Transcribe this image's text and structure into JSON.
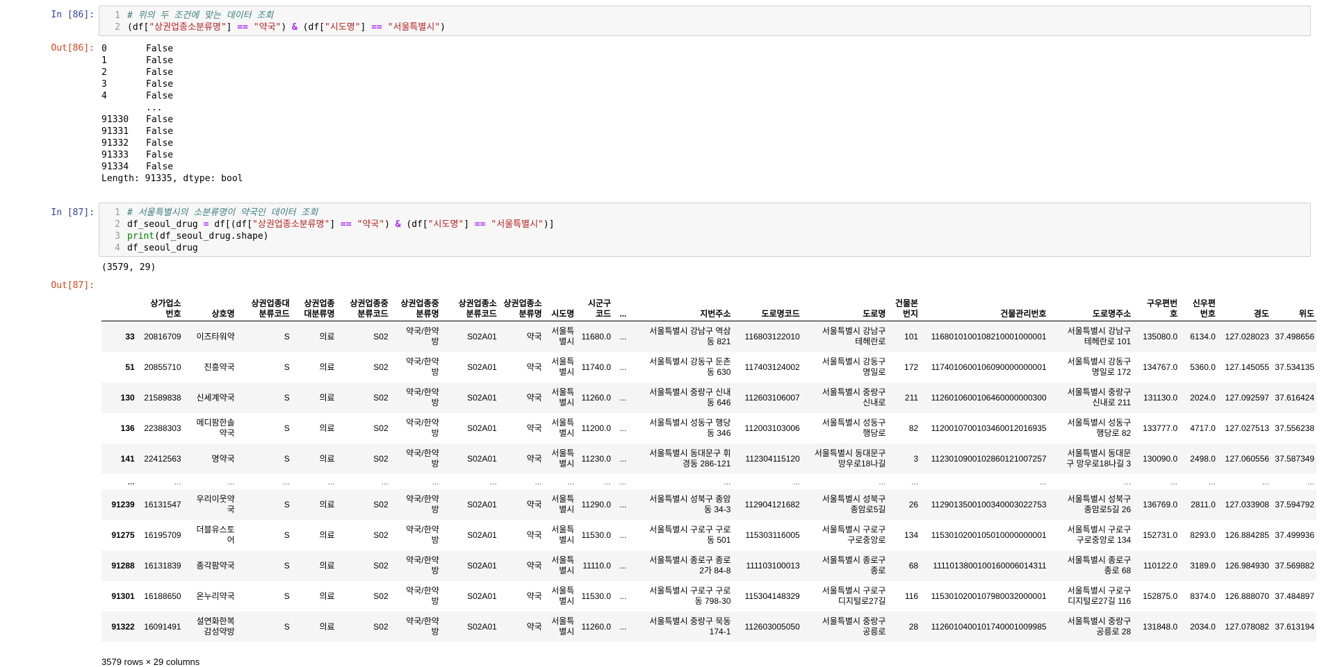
{
  "cell86": {
    "in_prompt": "In [86]:",
    "out_prompt": "Out[86]:",
    "code": [
      {
        "n": "1",
        "parts": [
          {
            "t": "# 위의 두 조건에 맞는 데이터 조회",
            "c": "comment"
          }
        ]
      },
      {
        "n": "2",
        "parts": [
          {
            "t": "(df[",
            "c": "paren"
          },
          {
            "t": "\"상권업종소분류명\"",
            "c": "str"
          },
          {
            "t": "] ",
            "c": "paren"
          },
          {
            "t": "==",
            "c": "op"
          },
          {
            "t": " ",
            "c": "paren"
          },
          {
            "t": "\"약국\"",
            "c": "str"
          },
          {
            "t": ") ",
            "c": "paren"
          },
          {
            "t": "&",
            "c": "op"
          },
          {
            "t": " (df[",
            "c": "paren"
          },
          {
            "t": "\"시도명\"",
            "c": "str"
          },
          {
            "t": "] ",
            "c": "paren"
          },
          {
            "t": "==",
            "c": "op"
          },
          {
            "t": " ",
            "c": "paren"
          },
          {
            "t": "\"서울특별시\"",
            "c": "str"
          },
          {
            "t": ")",
            "c": "paren"
          }
        ]
      }
    ],
    "series": [
      {
        "idx": "0",
        "val": "False"
      },
      {
        "idx": "1",
        "val": "False"
      },
      {
        "idx": "2",
        "val": "False"
      },
      {
        "idx": "3",
        "val": "False"
      },
      {
        "idx": "4",
        "val": "False"
      },
      {
        "idx": "",
        "val": "..."
      },
      {
        "idx": "91330",
        "val": "False"
      },
      {
        "idx": "91331",
        "val": "False"
      },
      {
        "idx": "91332",
        "val": "False"
      },
      {
        "idx": "91333",
        "val": "False"
      },
      {
        "idx": "91334",
        "val": "False"
      }
    ],
    "series_footer": "Length: 91335, dtype: bool"
  },
  "cell87": {
    "in_prompt": "In [87]:",
    "out_prompt": "Out[87]:",
    "code": [
      {
        "n": "1",
        "parts": [
          {
            "t": "# 서울특별시의 소분류명이 약국인 데이터 조회",
            "c": "comment"
          }
        ]
      },
      {
        "n": "2",
        "parts": [
          {
            "t": "df_seoul_drug ",
            "c": "paren"
          },
          {
            "t": "=",
            "c": "op"
          },
          {
            "t": " df[(df[",
            "c": "paren"
          },
          {
            "t": "\"상권업종소분류명\"",
            "c": "str"
          },
          {
            "t": "] ",
            "c": "paren"
          },
          {
            "t": "==",
            "c": "op"
          },
          {
            "t": " ",
            "c": "paren"
          },
          {
            "t": "\"약국\"",
            "c": "str"
          },
          {
            "t": ") ",
            "c": "paren"
          },
          {
            "t": "&",
            "c": "op"
          },
          {
            "t": " (df[",
            "c": "paren"
          },
          {
            "t": "\"시도명\"",
            "c": "str"
          },
          {
            "t": "] ",
            "c": "paren"
          },
          {
            "t": "==",
            "c": "op"
          },
          {
            "t": " ",
            "c": "paren"
          },
          {
            "t": "\"서울특별시\"",
            "c": "str"
          },
          {
            "t": ")]",
            "c": "paren"
          }
        ]
      },
      {
        "n": "3",
        "parts": [
          {
            "t": "print",
            "c": "kw"
          },
          {
            "t": "(df_seoul_drug.shape)",
            "c": "paren"
          }
        ]
      },
      {
        "n": "4",
        "parts": [
          {
            "t": "df_seoul_drug",
            "c": "paren"
          }
        ]
      }
    ],
    "stdout": "(3579, 29)",
    "table": {
      "columns": [
        "",
        "상가업소\n번호",
        "상호명",
        "상권업종대\n분류코드",
        "상권업종\n대분류명",
        "상권업종중\n분류코드",
        "상권업종중\n분류명",
        "상권업종소\n분류코드",
        "상권업종소\n분류명",
        "시도명",
        "시군구\n코드",
        "...",
        "지번주소",
        "도로명코드",
        "도로명",
        "건물본\n번지",
        "건물관리번호",
        "도로명주소",
        "구우편번\n호",
        "신우편\n번호",
        "경도",
        "위도"
      ],
      "rows": [
        [
          "33",
          "20816709",
          "이즈타워약",
          "S",
          "의료",
          "S02",
          "약국/한약\n방",
          "S02A01",
          "약국",
          "서울특\n별시",
          "11680.0",
          "...",
          "서울특별시 강남구 역삼\n동 821",
          "116803122010",
          "서울특별시 강남구\n테헤란로",
          "101",
          "1168010100108210001000001",
          "서울특별시 강남구\n테헤란로 101",
          "135080.0",
          "6134.0",
          "127.028023",
          "37.498656"
        ],
        [
          "51",
          "20855710",
          "진흥약국",
          "S",
          "의료",
          "S02",
          "약국/한약\n방",
          "S02A01",
          "약국",
          "서울특\n별시",
          "11740.0",
          "...",
          "서울특별시 강동구 둔촌\n동 630",
          "117403124002",
          "서울특별시 강동구\n명일로",
          "172",
          "1174010600106090000000001",
          "서울특별시 강동구\n명일로 172",
          "134767.0",
          "5360.0",
          "127.145055",
          "37.534135"
        ],
        [
          "130",
          "21589838",
          "신세계약국",
          "S",
          "의료",
          "S02",
          "약국/한약\n방",
          "S02A01",
          "약국",
          "서울특\n별시",
          "11260.0",
          "...",
          "서울특별시 중랑구 신내\n동 646",
          "112603106007",
          "서울특별시 중랑구\n신내로",
          "211",
          "1126010600106460000000300",
          "서울특별시 중랑구\n신내로 211",
          "131130.0",
          "2024.0",
          "127.092597",
          "37.616424"
        ],
        [
          "136",
          "22388303",
          "메디팜한솔\n약국",
          "S",
          "의료",
          "S02",
          "약국/한약\n방",
          "S02A01",
          "약국",
          "서울특\n별시",
          "11200.0",
          "...",
          "서울특별시 성동구 행당\n동 346",
          "112003103006",
          "서울특별시 성동구\n행당로",
          "82",
          "1120010700103460012016935",
          "서울특별시 성동구\n행당로 82",
          "133777.0",
          "4717.0",
          "127.027513",
          "37.556238"
        ],
        [
          "141",
          "22412563",
          "명약국",
          "S",
          "의료",
          "S02",
          "약국/한약\n방",
          "S02A01",
          "약국",
          "서울특\n별시",
          "11230.0",
          "...",
          "서울특별시 동대문구 휘\n경동 286-121",
          "112304115120",
          "서울특별시 동대문구\n망우로18나길",
          "3",
          "1123010900102860121007257",
          "서울특별시 동대문\n구 망우로18나길 3",
          "130090.0",
          "2498.0",
          "127.060556",
          "37.587349"
        ],
        [
          "...",
          "...",
          "...",
          "...",
          "...",
          "...",
          "...",
          "...",
          "...",
          "...",
          "...",
          "...",
          "...",
          "...",
          "...",
          "...",
          "...",
          "...",
          "...",
          "...",
          "...",
          "..."
        ],
        [
          "91239",
          "16131547",
          "우리이웃약\n국",
          "S",
          "의료",
          "S02",
          "약국/한약\n방",
          "S02A01",
          "약국",
          "서울특\n별시",
          "11290.0",
          "...",
          "서울특별시 성북구 종암\n동 34-3",
          "112904121682",
          "서울특별시 성북구\n종암로5길",
          "26",
          "1129013500100340003022753",
          "서울특별시 성북구\n종암로5길 26",
          "136769.0",
          "2811.0",
          "127.033908",
          "37.594792"
        ],
        [
          "91275",
          "16195709",
          "더블유스토\n어",
          "S",
          "의료",
          "S02",
          "약국/한약\n방",
          "S02A01",
          "약국",
          "서울특\n별시",
          "11530.0",
          "...",
          "서울특별시 구로구 구로\n동 501",
          "115303116005",
          "서울특별시 구로구\n구로중앙로",
          "134",
          "1153010200105010000000001",
          "서울특별시 구로구\n구로중앙로 134",
          "152731.0",
          "8293.0",
          "126.884285",
          "37.499936"
        ],
        [
          "91288",
          "16131839",
          "종각팜약국",
          "S",
          "의료",
          "S02",
          "약국/한약\n방",
          "S02A01",
          "약국",
          "서울특\n별시",
          "11110.0",
          "...",
          "서울특별시 종로구 종로\n2가 84-8",
          "111103100013",
          "서울특별시 종로구\n종로",
          "68",
          "1111013800100160006014311",
          "서울특별시 종로구\n종로 68",
          "110122.0",
          "3189.0",
          "126.984930",
          "37.569882"
        ],
        [
          "91301",
          "16188650",
          "온누리약국",
          "S",
          "의료",
          "S02",
          "약국/한약\n방",
          "S02A01",
          "약국",
          "서울특\n별시",
          "11530.0",
          "...",
          "서울특별시 구로구 구로\n동 798-30",
          "115304148329",
          "서울특별시 구로구\n디지털로27길",
          "116",
          "1153010200107980032000001",
          "서울특별시 구로구\n디지털로27길 116",
          "152875.0",
          "8374.0",
          "126.888070",
          "37.484897"
        ],
        [
          "91322",
          "16091491",
          "설연화한복\n감성약방",
          "S",
          "의료",
          "S02",
          "약국/한약\n방",
          "S02A01",
          "약국",
          "서울특\n별시",
          "11260.0",
          "...",
          "서울특별시 중랑구 묵동\n174-1",
          "112603005050",
          "서울특별시 중랑구\n공릉로",
          "28",
          "1126010400101740001009985",
          "서울특별시 중랑구\n공릉로 28",
          "131848.0",
          "2034.0",
          "127.078082",
          "37.613194"
        ]
      ],
      "footer": "3579 rows × 29 columns"
    }
  }
}
